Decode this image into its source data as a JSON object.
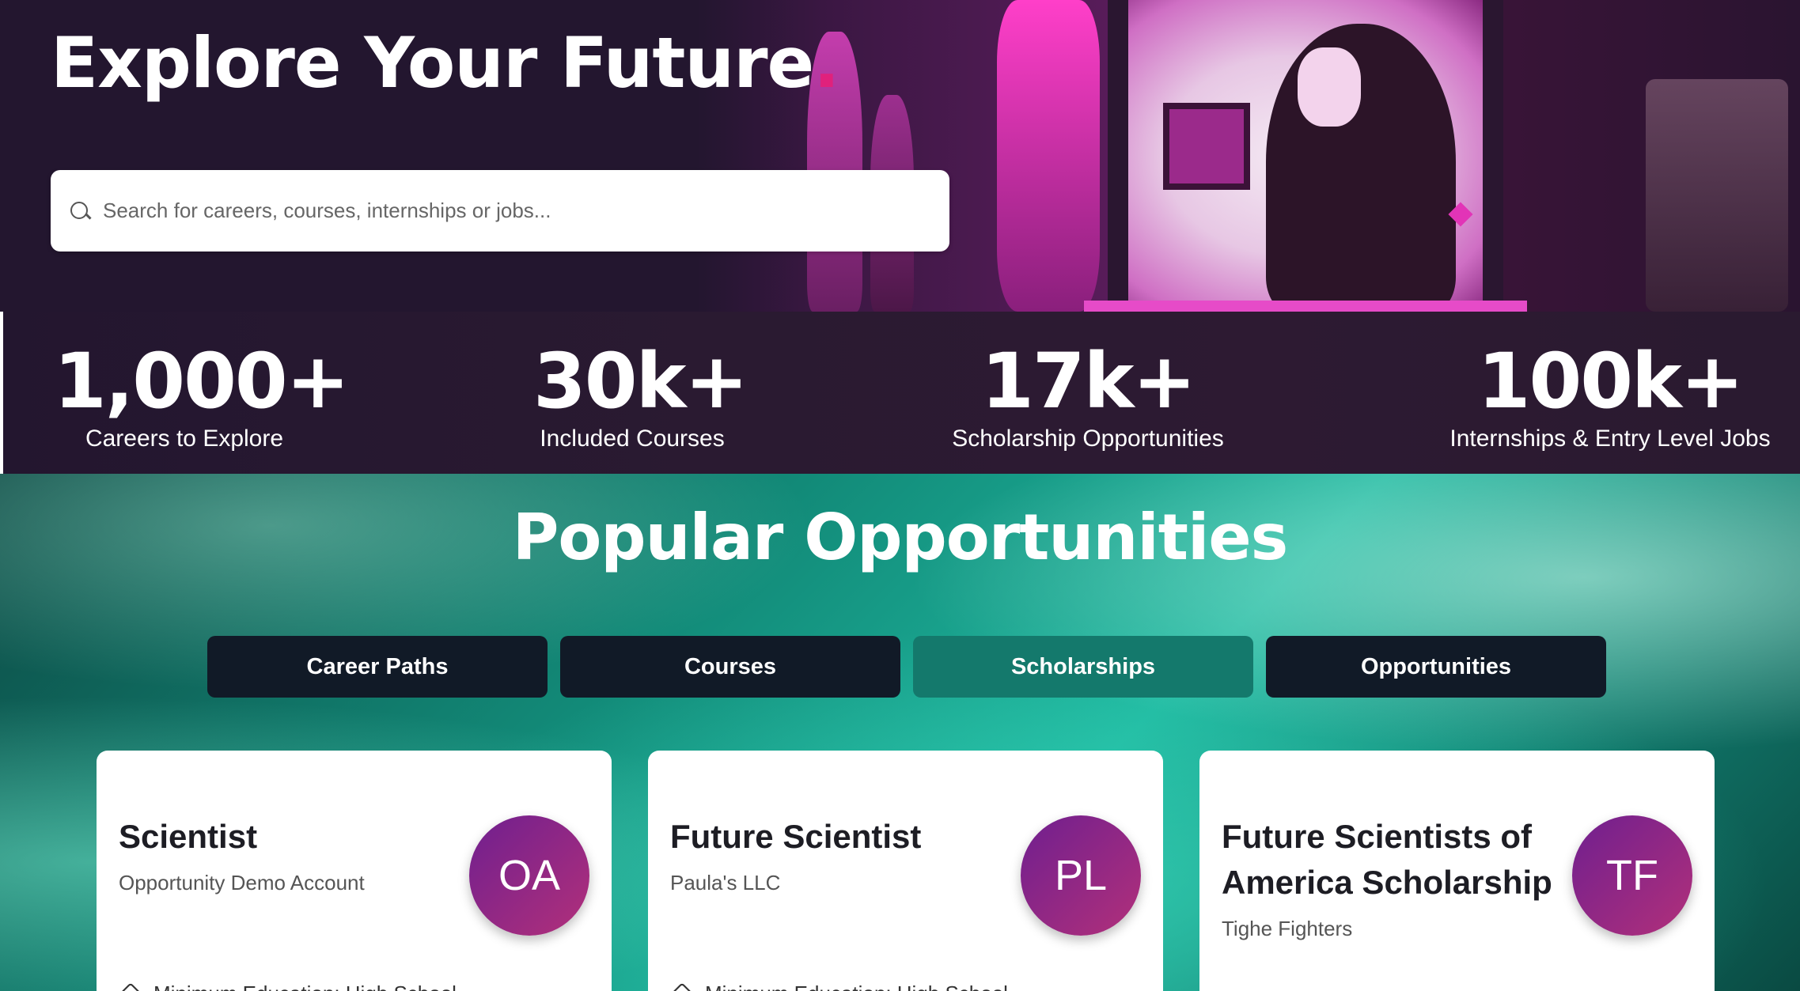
{
  "hero": {
    "title": "Explore Your Future",
    "title_dot": ".",
    "search_placeholder": "Search for careers, courses, internships or jobs..."
  },
  "stats": [
    {
      "value": "1,000+",
      "label": "Careers to Explore"
    },
    {
      "value": "30k+",
      "label": "Included Courses"
    },
    {
      "value": "17k+",
      "label": "Scholarship Opportunities"
    },
    {
      "value": "100k+",
      "label": "Internships & Entry Level Jobs"
    }
  ],
  "popular": {
    "title": "Popular Opportunities",
    "tabs": [
      {
        "label": "Career Paths",
        "active": false
      },
      {
        "label": "Courses",
        "active": false
      },
      {
        "label": "Scholarships",
        "active": true
      },
      {
        "label": "Opportunities",
        "active": false
      }
    ],
    "cards": [
      {
        "title": "Scientist",
        "org": "Opportunity Demo Account",
        "initials": "OA",
        "meta": "Minimum Education: High School"
      },
      {
        "title": "Future Scientist",
        "org": "Paula's LLC",
        "initials": "PL",
        "meta": "Minimum Education: High School"
      },
      {
        "title": "Future Scientists of America Scholarship",
        "org": "Tighe Fighters",
        "initials": "TF",
        "meta": ""
      }
    ]
  },
  "colors": {
    "hero_bg": "#23162f",
    "accent_dot": "#e0217c",
    "tab_bg": "#111a27",
    "tab_active_bg": "#14796c",
    "avatar_gradient_start": "#6f1f8f",
    "avatar_gradient_end": "#b2307a"
  },
  "icons": {
    "search": "search-icon",
    "education": "graduation-cap-icon"
  }
}
